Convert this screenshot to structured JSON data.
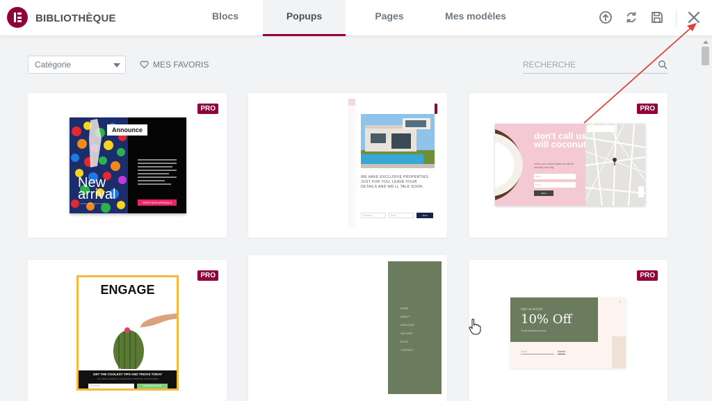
{
  "header": {
    "brand": "BIBLIOTHÈQUE",
    "tabs": [
      {
        "label": "Blocs",
        "active": false
      },
      {
        "label": "Popups",
        "active": true
      },
      {
        "label": "Pages",
        "active": false
      },
      {
        "label": "Mes modèles",
        "active": false
      }
    ],
    "icons": [
      "upload-icon",
      "sync-icon",
      "save-icon",
      "close-icon"
    ]
  },
  "toolbar": {
    "category_value": "Catégorie",
    "favorites_label": "MES FAVORIS",
    "search_placeholder": "RECHERCHE"
  },
  "badge_label": "PRO",
  "templates": [
    {
      "announce": "Announce",
      "headline1": "New",
      "headline2": "arrival",
      "collection": "2016 COLLECTION",
      "cta": "SHOP NEW ARRIVALS"
    },
    {
      "headline": "WE HAVE EXCLUSIVE PROPERTIES JUST FOR YOU, LEAVE YOUR DETAILS AND WE'LL TALK SOON.",
      "field1": "Full Name",
      "field2": "Email",
      "submit": "Send"
    },
    {
      "headline": "don't call us, we will coconut you",
      "subline": "Leave your contact details we will be reaching your way",
      "field1": "Name",
      "field2": "Email",
      "submit": "Send"
    },
    {
      "headline": "ENGAGE",
      "tagline": "GET THE COOLEST TIPS AND TRICKS TODAY",
      "body": "Our weekly newsletter is packed with practical tips and techniques.",
      "field": "Your Email",
      "cta": "DOWNLOAD NOW"
    },
    {
      "menu": [
        "HOME",
        "ABOUT",
        "SERVICES",
        "GALLERY",
        "BLOG",
        "CONTACT"
      ]
    },
    {
      "eyebrow": "Sign up and get",
      "headline": "10% Off",
      "subline": "On all cleaning services",
      "field": "Email",
      "submit": "Submit"
    }
  ],
  "colors": {
    "brand": "#92003b",
    "annotation_arrow": "#e0403a"
  }
}
